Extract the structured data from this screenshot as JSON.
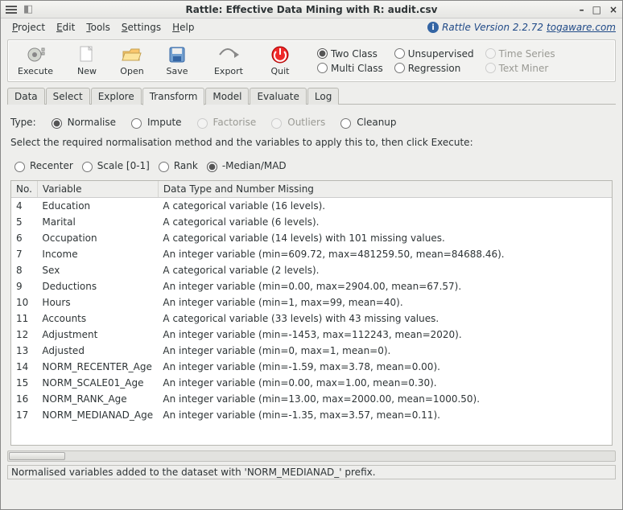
{
  "window": {
    "title": "Rattle: Effective Data Mining with R: audit.csv"
  },
  "menubar": {
    "items": [
      "Project",
      "Edit",
      "Tools",
      "Settings",
      "Help"
    ],
    "version_prefix": "Rattle Version 2.2.72",
    "version_link": "togaware.com"
  },
  "toolbar": {
    "execute": "Execute",
    "new": "New",
    "open": "Open",
    "save": "Save",
    "export": "Export",
    "quit": "Quit",
    "model_radios": {
      "two_class": "Two Class",
      "multi_class": "Multi Class",
      "unsupervised": "Unsupervised",
      "regression": "Regression",
      "time_series": "Time Series",
      "text_miner": "Text Miner"
    }
  },
  "tabs": [
    "Data",
    "Select",
    "Explore",
    "Transform",
    "Model",
    "Evaluate",
    "Log"
  ],
  "active_tab": "Transform",
  "transform": {
    "type_label": "Type:",
    "types": {
      "normalise": "Normalise",
      "impute": "Impute",
      "factorise": "Factorise",
      "outliers": "Outliers",
      "cleanup": "Cleanup"
    },
    "instruction": "Select the required normalisation method and the variables to apply this to, then click Execute:",
    "methods": {
      "recenter": "Recenter",
      "scale01": "Scale [0-1]",
      "rank": "Rank",
      "medianmad": "-Median/MAD"
    },
    "columns": {
      "no": "No.",
      "variable": "Variable",
      "datatype": "Data Type and Number Missing"
    },
    "rows": [
      {
        "no": "4",
        "var": "Education",
        "desc": "A categorical variable (16 levels)."
      },
      {
        "no": "5",
        "var": "Marital",
        "desc": "A categorical variable (6 levels)."
      },
      {
        "no": "6",
        "var": "Occupation",
        "desc": "A categorical variable (14 levels) with 101 missing values."
      },
      {
        "no": "7",
        "var": "Income",
        "desc": "An integer variable (min=609.72, max=481259.50, mean=84688.46)."
      },
      {
        "no": "8",
        "var": "Sex",
        "desc": "A categorical variable (2 levels)."
      },
      {
        "no": "9",
        "var": "Deductions",
        "desc": "An integer variable (min=0.00, max=2904.00, mean=67.57)."
      },
      {
        "no": "10",
        "var": "Hours",
        "desc": "An integer variable (min=1, max=99, mean=40)."
      },
      {
        "no": "11",
        "var": "Accounts",
        "desc": "A categorical variable (33 levels) with 43 missing values."
      },
      {
        "no": "12",
        "var": "Adjustment",
        "desc": "An integer variable (min=-1453, max=112243, mean=2020)."
      },
      {
        "no": "13",
        "var": "Adjusted",
        "desc": "An integer variable (min=0, max=1, mean=0)."
      },
      {
        "no": "14",
        "var": "NORM_RECENTER_Age",
        "desc": "An integer variable (min=-1.59, max=3.78, mean=0.00)."
      },
      {
        "no": "15",
        "var": "NORM_SCALE01_Age",
        "desc": "An integer variable (min=0.00, max=1.00, mean=0.30)."
      },
      {
        "no": "16",
        "var": "NORM_RANK_Age",
        "desc": "An integer variable (min=13.00, max=2000.00, mean=1000.50)."
      },
      {
        "no": "17",
        "var": "NORM_MEDIANAD_Age",
        "desc": "An integer variable (min=-1.35, max=3.57, mean=0.11)."
      }
    ]
  },
  "status": "Normalised variables added to the dataset with 'NORM_MEDIANAD_' prefix."
}
